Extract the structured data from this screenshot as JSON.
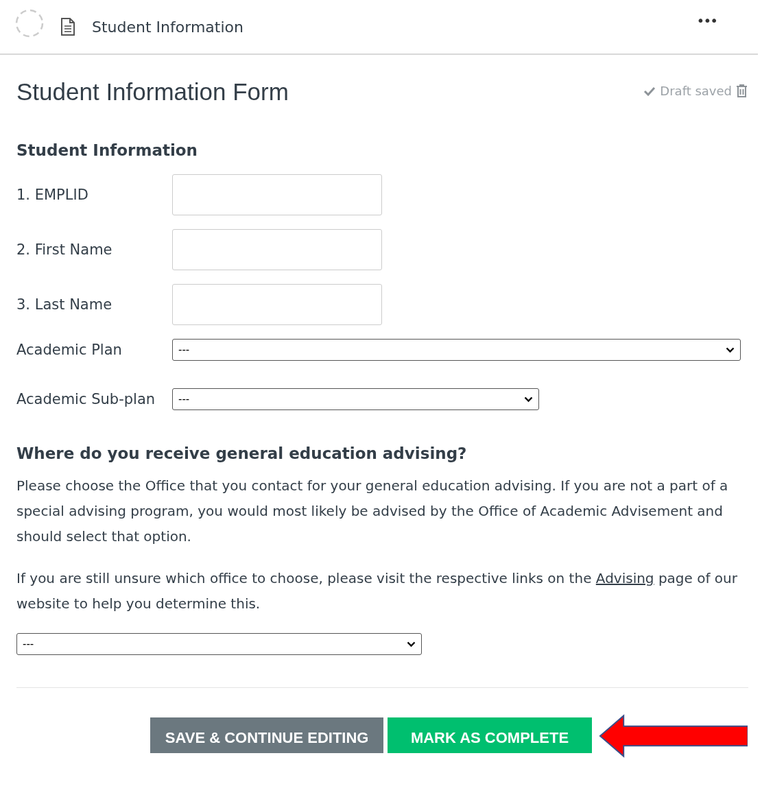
{
  "header": {
    "title": "Student Information",
    "menu": "•••"
  },
  "form": {
    "title": "Student Information Form",
    "status": "Draft saved",
    "section": "Student Information",
    "fields": [
      {
        "kind": "text",
        "label": "1. EMPLID"
      },
      {
        "kind": "text",
        "label": "2. First Name"
      },
      {
        "kind": "text",
        "label": "3. Last Name"
      },
      {
        "kind": "long-select",
        "label": "Academic Plan",
        "value": "---"
      },
      {
        "kind": "short-select",
        "label": "Academic Sub-plan",
        "value": "---"
      }
    ]
  },
  "question": {
    "title": "Where do you receive general education advising?",
    "paragraph": "Please choose the Office that you contact for your general education advising. If you are not a part of a special advising program, you would most likely be advised by the Office of Academic Advisement and should select that option.",
    "note": {
      "before": "If you are still unsure which office to choose, please visit the respective links on the ",
      "link": "Advising",
      "after": " page of our website to help you determine this."
    },
    "select": {
      "value": "---"
    }
  },
  "buttons": [
    {
      "kind": "secondary",
      "label": "SAVE & CONTINUE EDITING"
    },
    {
      "kind": "primary",
      "label": "MARK AS COMPLETE"
    }
  ]
}
